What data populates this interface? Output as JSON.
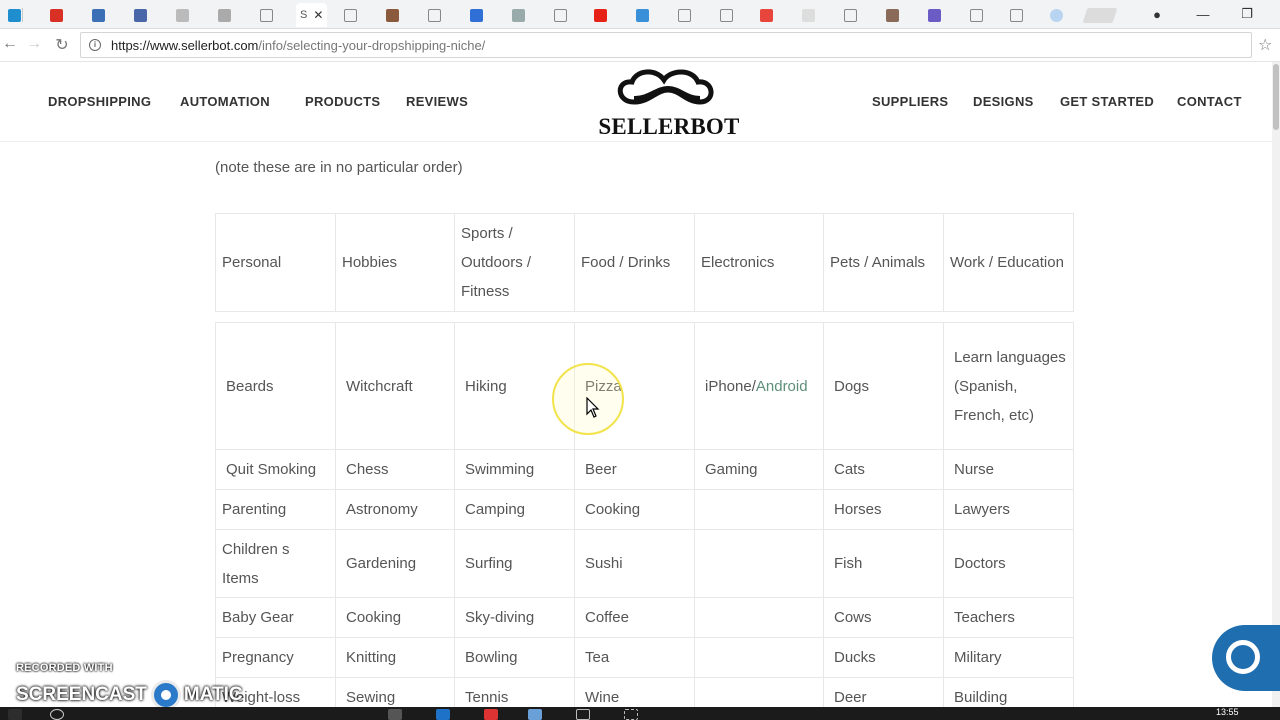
{
  "browser": {
    "active_tab_label": "S",
    "address": {
      "host": "https://www.sellerbot.com",
      "path": "/info/selecting-your-dropshipping-niche/"
    }
  },
  "site": {
    "brand": "SELLERBOT",
    "nav_left": [
      "DROPSHIPPING",
      "AUTOMATION",
      "PRODUCTS",
      "REVIEWS"
    ],
    "nav_right": [
      "SUPPLIERS",
      "DESIGNS",
      "GET STARTED",
      "CONTACT"
    ]
  },
  "content": {
    "note": "(note these are in no particular order)",
    "table": {
      "headers": [
        "Personal",
        "Hobbies",
        "Sports / Outdoors / Fitness",
        "Food / Drinks",
        "Electronics",
        "Pets / Animals",
        "Work / Education"
      ],
      "rows": [
        [
          "Beards",
          "Witchcraft",
          "Hiking",
          "Pizza",
          "iPhone/",
          "Dogs",
          "Learn languages (Spanish, French, etc)"
        ],
        [
          "Quit Smoking",
          "Chess",
          "Swimming",
          "Beer",
          "Gaming",
          "Cats",
          "Nurse"
        ],
        [
          "Parenting",
          "Astronomy",
          "Camping",
          "Cooking",
          "",
          "Horses",
          "Lawyers"
        ],
        [
          "Children s Items",
          "Gardening",
          "Surfing",
          "Sushi",
          "",
          "Fish",
          "Doctors"
        ],
        [
          "Baby Gear",
          "Cooking",
          "Sky-diving",
          "Coffee",
          "",
          "Cows",
          "Teachers"
        ],
        [
          "Pregnancy",
          "Knitting",
          "Bowling",
          "Tea",
          "",
          "Ducks",
          "Military"
        ],
        [
          "Weight-loss",
          "Sewing",
          "Tennis",
          "Wine",
          "",
          "Deer",
          "Building"
        ]
      ],
      "electronics_link": "Android"
    }
  },
  "watermark": {
    "line1": "RECORDED WITH",
    "line2a": "SCREENCAST",
    "line2b": "MATIC"
  },
  "taskbar": {
    "time": "13:55"
  }
}
